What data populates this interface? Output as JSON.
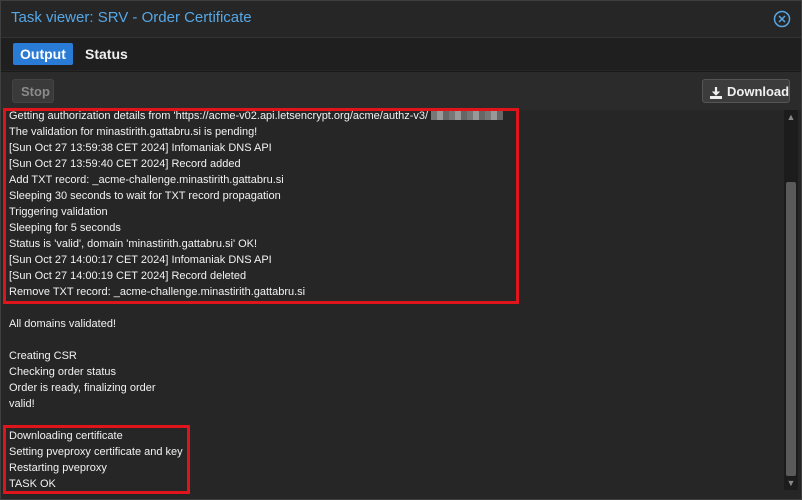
{
  "window": {
    "title": "Task viewer: SRV - Order Certificate",
    "close_icon": "close-circle-icon"
  },
  "tabs": [
    {
      "label": "Output",
      "active": true
    },
    {
      "label": "Status",
      "active": false
    }
  ],
  "toolbar": {
    "stop_label": "Stop",
    "download_label": "Download",
    "download_icon": "download-icon"
  },
  "log": {
    "lines": [
      "Getting authorization details from 'https://acme-v02.api.letsencrypt.org/acme/authz-v3/",
      "The validation for minastirith.gattabru.si is pending!",
      "[Sun Oct 27 13:59:38 CET 2024] Infomaniak DNS API",
      "[Sun Oct 27 13:59:40 CET 2024] Record added",
      "Add TXT record: _acme-challenge.minastirith.gattabru.si",
      "Sleeping 30 seconds to wait for TXT record propagation",
      "Triggering validation",
      "Sleeping for 5 seconds",
      "Status is 'valid', domain 'minastirith.gattabru.si' OK!",
      "[Sun Oct 27 14:00:17 CET 2024] Infomaniak DNS API",
      "[Sun Oct 27 14:00:19 CET 2024] Record deleted",
      "Remove TXT record: _acme-challenge.minastirith.gattabru.si",
      "",
      "All domains validated!",
      "",
      "Creating CSR",
      "Checking order status",
      "Order is ready, finalizing order",
      "valid!",
      "",
      "Downloading certificate",
      "Setting pveproxy certificate and key",
      "Restarting pveproxy",
      "TASK OK"
    ]
  },
  "colors": {
    "title": "#56a7e6",
    "active_tab": "#2a7bd6",
    "highlight": "#e0141b",
    "background": "#262626"
  }
}
